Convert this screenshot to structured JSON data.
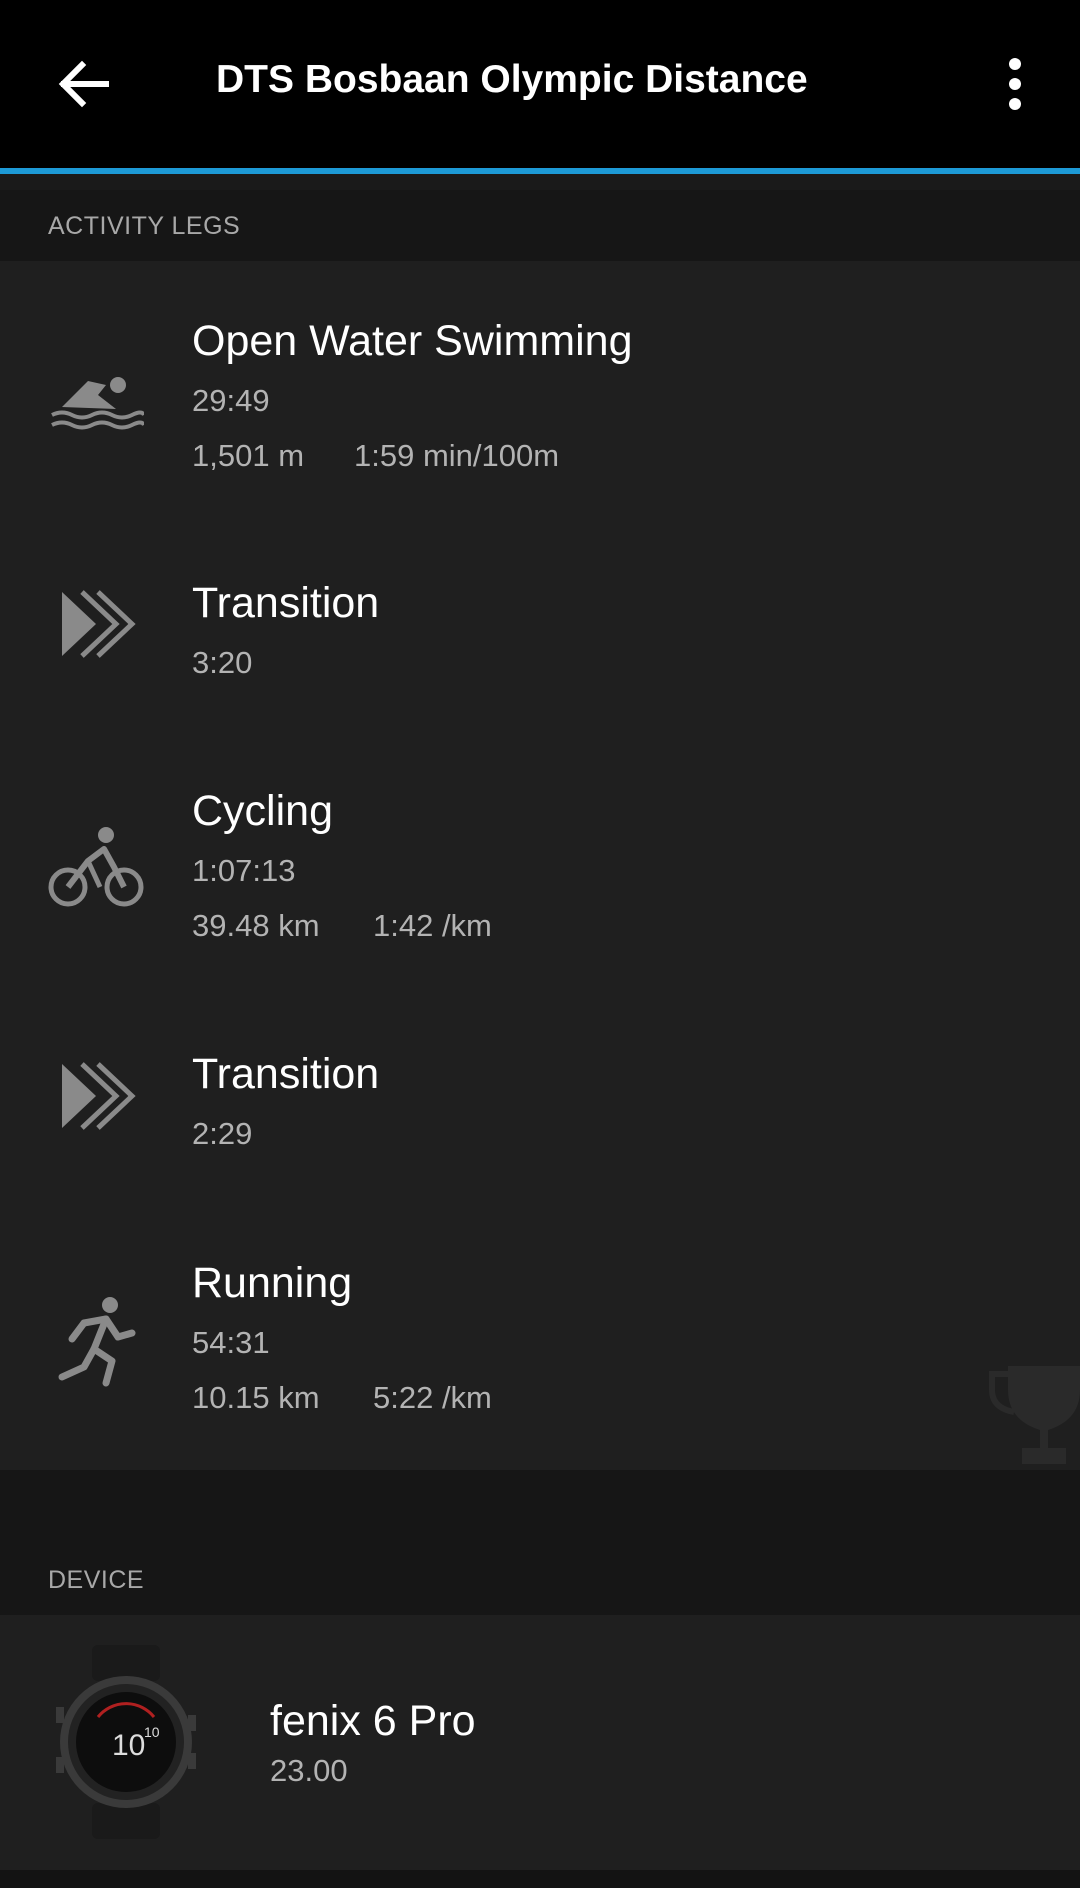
{
  "header": {
    "title": "DTS Bosbaan Olympic Distance",
    "back_icon": "arrow-left-icon",
    "more_icon": "more-vertical-icon"
  },
  "activity_legs": {
    "section_label": "ACTIVITY LEGS",
    "items": [
      {
        "name": "Open Water Swimming",
        "time": "29:49",
        "distance": "1,501 m",
        "pace": "1:59 min/100m",
        "icon": "swim-icon"
      },
      {
        "name": "Transition",
        "time": "3:20",
        "icon": "transition-icon"
      },
      {
        "name": "Cycling",
        "time": "1:07:13",
        "distance": "39.48 km",
        "pace": "1:42 /km",
        "icon": "bike-icon"
      },
      {
        "name": "Transition",
        "time": "2:29",
        "icon": "transition-icon"
      },
      {
        "name": "Running",
        "time": "54:31",
        "distance": "10.15 km",
        "pace": "5:22 /km",
        "icon": "run-icon"
      }
    ]
  },
  "device": {
    "section_label": "DEVICE",
    "name": "fenix 6 Pro",
    "version": "23.00",
    "image": "watch-image"
  },
  "colors": {
    "accent": "#1d9ad6",
    "background": "#1f1f1f",
    "header": "#000000"
  }
}
